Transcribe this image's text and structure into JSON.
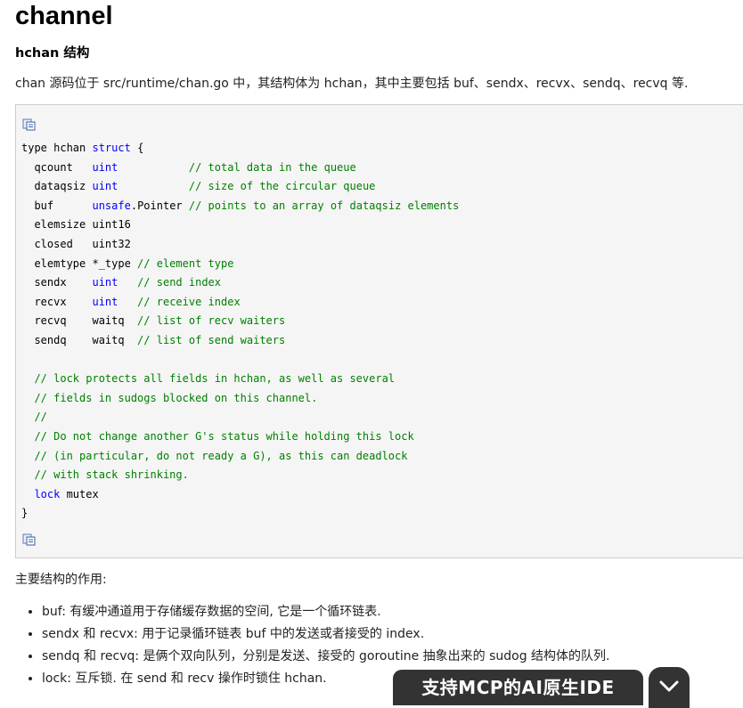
{
  "title": "channel",
  "subtitle": "hchan 结构",
  "intro": "chan 源码位于 src/runtime/chan.go 中，其结构体为 hchan，其中主要包括 buf、sendx、recvx、sendq、recvq 等.",
  "code": {
    "copy_icon_top": "copy-code-icon",
    "copy_icon_bottom": "copy-code-icon",
    "lines": [
      [
        [
          "t",
          "type hchan "
        ],
        [
          "kw",
          "struct"
        ],
        [
          "t",
          " {"
        ]
      ],
      [
        [
          "t",
          "  qcount   "
        ],
        [
          "kw",
          "uint"
        ],
        [
          "t",
          "           "
        ],
        [
          "cm",
          "// total data in the queue"
        ]
      ],
      [
        [
          "t",
          "  dataqsiz "
        ],
        [
          "kw",
          "uint"
        ],
        [
          "t",
          "           "
        ],
        [
          "cm",
          "// size of the circular queue"
        ]
      ],
      [
        [
          "t",
          "  buf      "
        ],
        [
          "kw",
          "unsafe"
        ],
        [
          "t",
          ".Pointer "
        ],
        [
          "cm",
          "// points to an array of dataqsiz elements"
        ]
      ],
      [
        [
          "t",
          "  elemsize uint16"
        ]
      ],
      [
        [
          "t",
          "  closed   uint32"
        ]
      ],
      [
        [
          "t",
          "  elemtype *_type "
        ],
        [
          "cm",
          "// element type"
        ]
      ],
      [
        [
          "t",
          "  sendx    "
        ],
        [
          "kw",
          "uint"
        ],
        [
          "t",
          "   "
        ],
        [
          "cm",
          "// send index"
        ]
      ],
      [
        [
          "t",
          "  recvx    "
        ],
        [
          "kw",
          "uint"
        ],
        [
          "t",
          "   "
        ],
        [
          "cm",
          "// receive index"
        ]
      ],
      [
        [
          "t",
          "  recvq    waitq  "
        ],
        [
          "cm",
          "// list of recv waiters"
        ]
      ],
      [
        [
          "t",
          "  sendq    waitq  "
        ],
        [
          "cm",
          "// list of send waiters"
        ]
      ],
      [
        [
          "t",
          ""
        ]
      ],
      [
        [
          "t",
          "  "
        ],
        [
          "cm",
          "// lock protects all fields in hchan, as well as several"
        ]
      ],
      [
        [
          "t",
          "  "
        ],
        [
          "cm",
          "// fields in sudogs blocked on this channel."
        ]
      ],
      [
        [
          "t",
          "  "
        ],
        [
          "cm",
          "//"
        ]
      ],
      [
        [
          "t",
          "  "
        ],
        [
          "cm",
          "// Do not change another G's status while holding this lock"
        ]
      ],
      [
        [
          "t",
          "  "
        ],
        [
          "cm",
          "// (in particular, do not ready a G), as this can deadlock"
        ]
      ],
      [
        [
          "t",
          "  "
        ],
        [
          "cm",
          "// with stack shrinking."
        ]
      ],
      [
        [
          "t",
          "  "
        ],
        [
          "kw",
          "lock"
        ],
        [
          "t",
          " mutex"
        ]
      ],
      [
        [
          "t",
          "}"
        ]
      ]
    ]
  },
  "structure_heading": "主要结构的作用:",
  "items": [
    "buf: 有缓冲通道用于存储缓存数据的空间, 它是一个循环链表.",
    "sendx 和 recvx: 用于记录循环链表 buf 中的发送或者接受的 index.",
    "sendq 和 recvq: 是俩个双向队列，分别是发送、接受的 goroutine 抽象出来的 sudog 结构体的队列.",
    "lock: 互斥锁. 在 send 和 recv 操作时锁住 hchan."
  ],
  "banner": {
    "text": "支持MCP的AI原生IDE",
    "toggle_icon": "chevron-down-icon"
  },
  "colors": {
    "keyword": "#0000ff",
    "comment": "#008000",
    "code_bg": "#f5f5f5",
    "banner_bg": "#333333"
  }
}
